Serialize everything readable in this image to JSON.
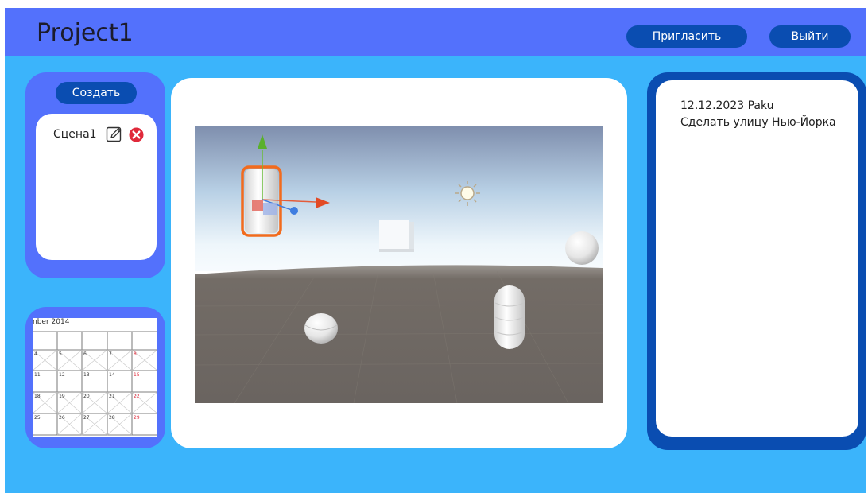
{
  "header": {
    "title": "Project1",
    "invite_label": "Пригласить",
    "logout_label": "Выйти"
  },
  "scenes": {
    "create_label": "Создать",
    "items": [
      {
        "label": "Сцена1",
        "edit_icon": "pencil-edit-icon",
        "delete_icon": "close-circle-icon"
      }
    ]
  },
  "calendar": {
    "month_label": "nber  2014",
    "days": [
      "4",
      "5",
      "6",
      "7",
      "8",
      "11",
      "12",
      "13",
      "14",
      "15",
      "18",
      "19",
      "20",
      "21",
      "22",
      "25",
      "26",
      "27",
      "28",
      "29"
    ]
  },
  "notes": {
    "entries": [
      {
        "header": "12.12.2023 Paku",
        "text": "Сделать улицу Нью-Йорка"
      }
    ]
  },
  "colors": {
    "background": "#3bb4fb",
    "header_bar": "#5371fc",
    "button": "#0a4db1",
    "panel": "#5371fc",
    "notes_border": "#0a4db1",
    "delete_red": "#e0293a",
    "selection_orange": "#f26b1d"
  }
}
